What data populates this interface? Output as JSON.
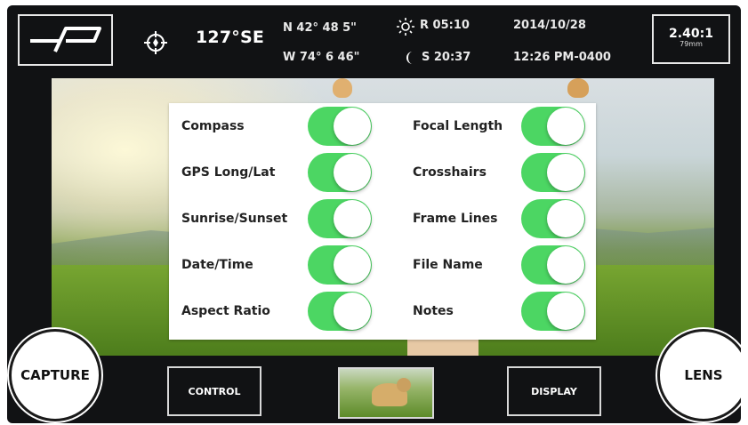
{
  "topbar": {
    "heading": "127°SE",
    "gps_lat": "N 42° 48 5\"",
    "gps_long": "W 74° 6 46\"",
    "sunrise": "R 05:10",
    "sunset": "S 20:37",
    "date": "2014/10/28",
    "time": "12:26 PM-0400",
    "aspect_ratio": "2.40:1",
    "focal_length": "79mm"
  },
  "settings": {
    "left": [
      {
        "label": "Compass",
        "on": true
      },
      {
        "label": "GPS Long/Lat",
        "on": true
      },
      {
        "label": "Sunrise/Sunset",
        "on": true
      },
      {
        "label": "Date/Time",
        "on": true
      },
      {
        "label": "Aspect Ratio",
        "on": true
      }
    ],
    "right": [
      {
        "label": "Focal Length",
        "on": true
      },
      {
        "label": "Crosshairs",
        "on": true
      },
      {
        "label": "Frame Lines",
        "on": true
      },
      {
        "label": "File Name",
        "on": true
      },
      {
        "label": "Notes",
        "on": true
      }
    ]
  },
  "bottombar": {
    "capture_label": "CAPTURE",
    "control_label": "CONTROL",
    "display_label": "DISPLAY",
    "lens_label": "LENS"
  },
  "colors": {
    "toggle_on": "#4cd663",
    "background": "#111214"
  }
}
